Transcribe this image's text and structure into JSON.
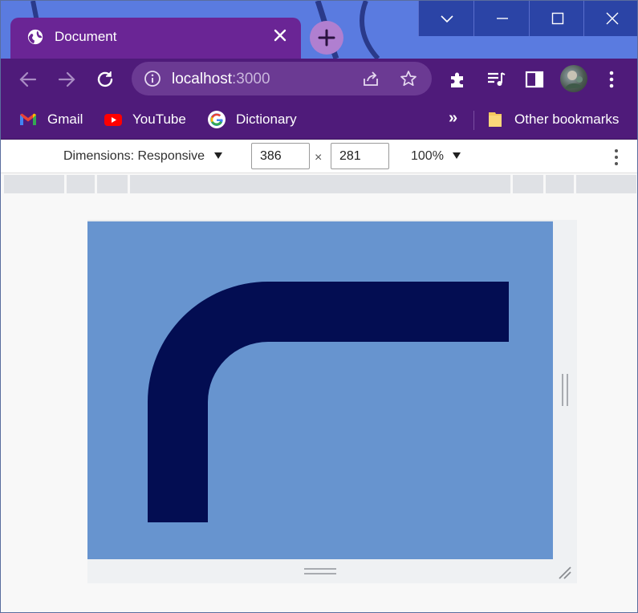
{
  "window": {
    "controls": [
      "chevron-down-icon",
      "minimize-icon",
      "maximize-icon",
      "close-icon"
    ]
  },
  "tab": {
    "title": "Document",
    "favicon": "globe-icon",
    "close_icon": "close-icon"
  },
  "toolbar": {
    "back_icon": "back-arrow-icon",
    "forward_icon": "forward-arrow-icon",
    "reload_icon": "reload-icon",
    "url_host": "localhost",
    "url_port": ":3000",
    "extensions_icon": "puzzle-icon",
    "media_icon": "media-queue-icon",
    "sidepanel_icon": "side-panel-icon",
    "menu_icon": "kebab-menu-icon"
  },
  "bookmarks": {
    "items": [
      {
        "label": "Gmail",
        "icon": "gmail-icon"
      },
      {
        "label": "YouTube",
        "icon": "youtube-icon"
      },
      {
        "label": "Dictionary",
        "icon": "google-icon"
      }
    ],
    "more": "»",
    "other": {
      "label": "Other bookmarks",
      "icon": "folder-icon"
    }
  },
  "devtools": {
    "dimensions_label": "Dimensions: Responsive",
    "width": "386",
    "times": "×",
    "height": "281",
    "zoom": "100%"
  },
  "colors": {
    "tabstrip": "#5a7be0",
    "tab": "#6a2595",
    "toolbar": "#4f1b7a",
    "page_background": "#6794cf",
    "shape_fill": "#030d52"
  }
}
